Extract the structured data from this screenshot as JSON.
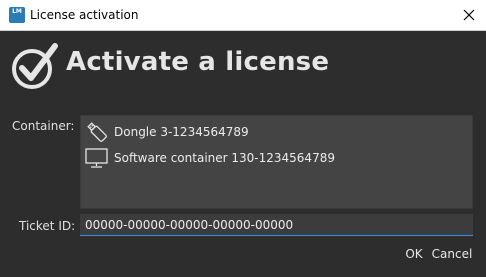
{
  "window": {
    "title": "License activation",
    "app_icon_text": "LM"
  },
  "header": {
    "title": "Activate a license"
  },
  "container_field": {
    "label": "Container:",
    "items": [
      {
        "icon": "usb-dongle-icon",
        "label": "Dongle 3-1234564789"
      },
      {
        "icon": "monitor-icon",
        "label": "Software container 130-1234564789"
      }
    ]
  },
  "ticket_field": {
    "label": "Ticket ID:",
    "value": "00000-00000-00000-00000-00000"
  },
  "buttons": {
    "ok": "OK",
    "cancel": "Cancel"
  },
  "colors": {
    "background": "#2d2d2d",
    "list_background": "#444444",
    "accent": "#3d8ee0"
  }
}
